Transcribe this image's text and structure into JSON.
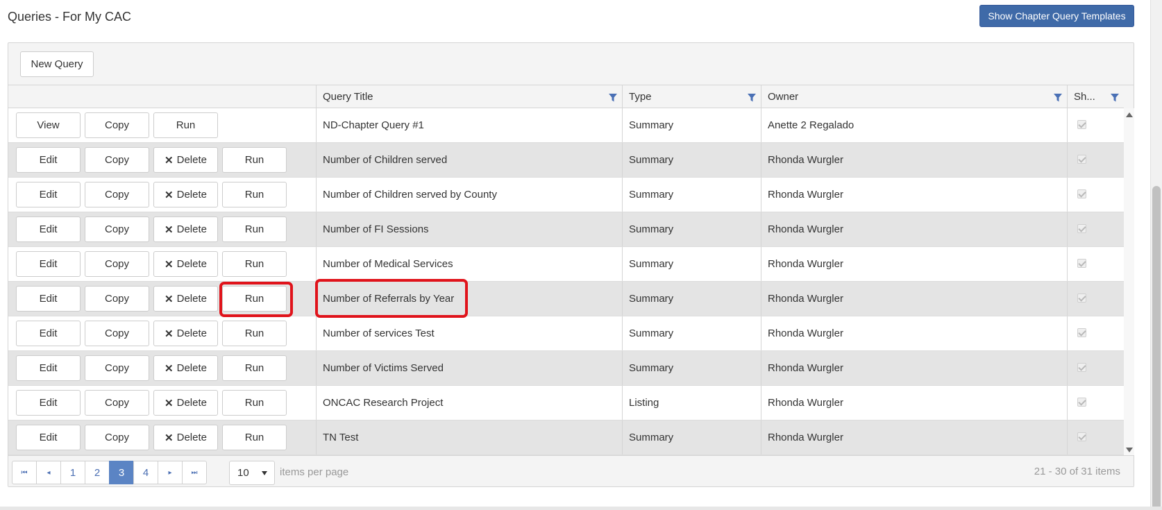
{
  "page": {
    "title": "Queries - For My CAC",
    "templates_button": "Show Chapter Query Templates"
  },
  "toolbar": {
    "new_query": "New Query"
  },
  "columns": {
    "title": "Query Title",
    "type": "Type",
    "owner": "Owner",
    "shared": "Sh..."
  },
  "buttons": {
    "view": "View",
    "edit": "Edit",
    "copy": "Copy",
    "delete": "Delete",
    "delete_icon": "✕",
    "run": "Run"
  },
  "rows": [
    {
      "title": "ND-Chapter Query #1",
      "type": "Summary",
      "owner": "Anette 2 Regalado",
      "mode": "view",
      "shared": true
    },
    {
      "title": "Number of Children served",
      "type": "Summary",
      "owner": "Rhonda Wurgler",
      "mode": "edit",
      "shared": true
    },
    {
      "title": "Number of Children served by County",
      "type": "Summary",
      "owner": "Rhonda Wurgler",
      "mode": "edit",
      "shared": true
    },
    {
      "title": "Number of FI Sessions",
      "type": "Summary",
      "owner": "Rhonda Wurgler",
      "mode": "edit",
      "shared": true
    },
    {
      "title": "Number of Medical Services",
      "type": "Summary",
      "owner": "Rhonda Wurgler",
      "mode": "edit",
      "shared": true
    },
    {
      "title": "Number of Referrals by Year",
      "type": "Summary",
      "owner": "Rhonda Wurgler",
      "mode": "edit",
      "shared": true
    },
    {
      "title": "Number of services Test",
      "type": "Summary",
      "owner": "Rhonda Wurgler",
      "mode": "edit",
      "shared": true
    },
    {
      "title": "Number of Victims Served",
      "type": "Summary",
      "owner": "Rhonda Wurgler",
      "mode": "edit",
      "shared": true
    },
    {
      "title": "ONCAC Research Project",
      "type": "Listing",
      "owner": "Rhonda Wurgler",
      "mode": "edit",
      "shared": true
    },
    {
      "title": "TN Test",
      "type": "Summary",
      "owner": "Rhonda Wurgler",
      "mode": "edit",
      "shared": true
    }
  ],
  "pager": {
    "first_icon": "⏮",
    "prev_icon": "◂",
    "next_icon": "▸",
    "last_icon": "⏭",
    "pages": [
      "1",
      "2",
      "3",
      "4"
    ],
    "current_page": "3",
    "page_size": "10",
    "items_per_page": "items per page",
    "info": "21 - 30 of 31 items"
  },
  "colors": {
    "accent": "#3f6aa8",
    "pager_active": "#5b84c4",
    "highlight": "#e0131b",
    "row_alt": "#e4e4e4"
  }
}
